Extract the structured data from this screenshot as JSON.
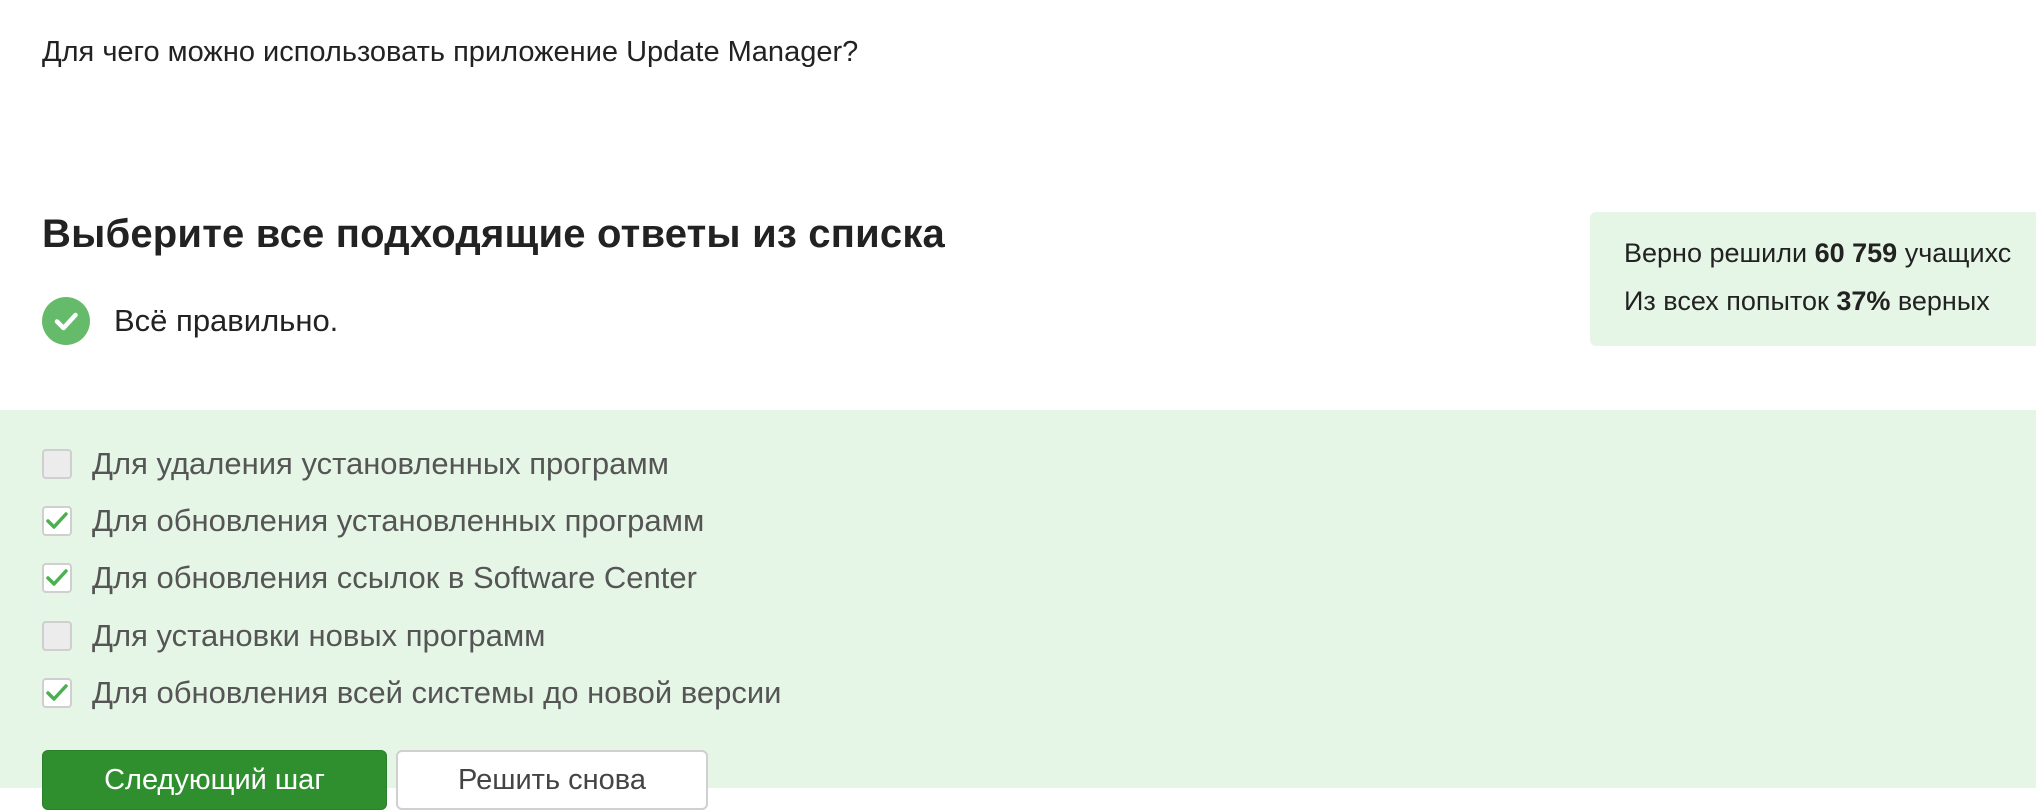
{
  "question": {
    "text": "Для чего можно использовать приложение Update Manager?"
  },
  "instruction": {
    "heading": "Выберите все подходящие ответы из списка"
  },
  "result": {
    "status_text": "Всё правильно.",
    "icon": "check-circle-icon",
    "accent_color": "#66bb6a"
  },
  "stats": {
    "line1_prefix": "Верно решили ",
    "line1_value": "60 759",
    "line1_suffix": " учащихс",
    "line2_prefix": "Из всех попыток ",
    "line2_value": "37%",
    "line2_suffix": " верных"
  },
  "options": [
    {
      "label": "Для удаления установленных программ",
      "checked": false
    },
    {
      "label": "Для обновления установленных программ",
      "checked": true
    },
    {
      "label": "Для обновления ссылок в Software Center",
      "checked": true
    },
    {
      "label": "Для установки новых программ",
      "checked": false
    },
    {
      "label": "Для обновления всей системы до новой версии",
      "checked": true
    }
  ],
  "buttons": {
    "next_label": "Следующий шаг",
    "retry_label": "Решить снова"
  },
  "colors": {
    "panel_background": "#e6f6e6",
    "primary_button": "#2f8f2f",
    "check_mark": "#4caf50"
  }
}
